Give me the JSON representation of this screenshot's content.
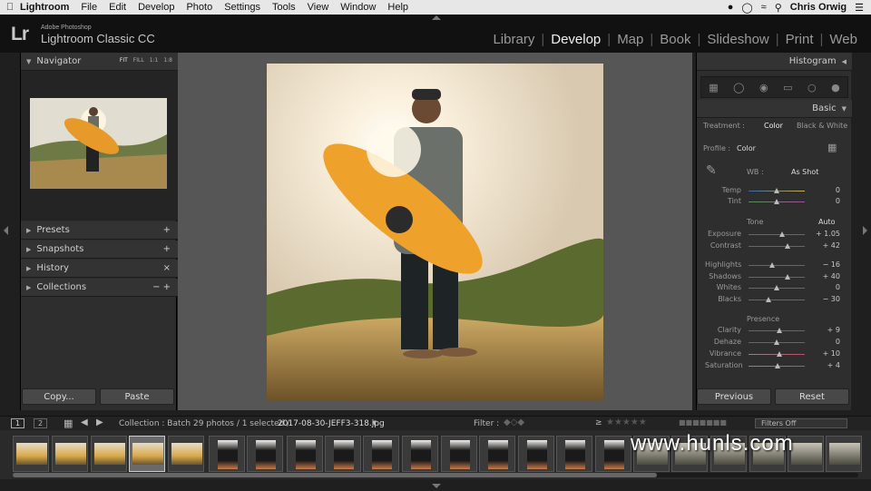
{
  "macbar": {
    "app": "Lightroom",
    "menus": [
      "File",
      "Edit",
      "Develop",
      "Photo",
      "Settings",
      "Tools",
      "View",
      "Window",
      "Help"
    ],
    "user": "Chris Orwig"
  },
  "header": {
    "logo": "Lr",
    "brand_top": "Adobe Photoshop",
    "brand_main": "Lightroom Classic CC",
    "modules": [
      "Library",
      "Develop",
      "Map",
      "Book",
      "Slideshow",
      "Print",
      "Web"
    ],
    "active_module": "Develop"
  },
  "left_panel": {
    "navigator_title": "Navigator",
    "nav_modes": [
      "FIT",
      "FILL",
      "1:1",
      "1:8"
    ],
    "sections": [
      {
        "title": "Presets",
        "action": "+"
      },
      {
        "title": "Snapshots",
        "action": "+"
      },
      {
        "title": "History",
        "action": "×"
      },
      {
        "title": "Collections",
        "action": "− +"
      }
    ],
    "copy_label": "Copy...",
    "paste_label": "Paste"
  },
  "right_panel": {
    "histogram_title": "Histogram",
    "basic_title": "Basic",
    "treatment_label": "Treatment :",
    "treatment_color": "Color",
    "treatment_bw": "Black & White",
    "profile_label": "Profile :",
    "profile_value": "Color",
    "wb_label": "WB :",
    "wb_value": "As Shot",
    "tone_label": "Tone",
    "auto_label": "Auto",
    "presence_label": "Presence",
    "sliders": [
      {
        "label": "Temp",
        "value": "0",
        "pos": 0.5
      },
      {
        "label": "Tint",
        "value": "0",
        "pos": 0.5
      },
      {
        "label": "Exposure",
        "value": "+ 1.05",
        "pos": 0.6
      },
      {
        "label": "Contrast",
        "value": "+ 42",
        "pos": 0.7
      },
      {
        "label": "Highlights",
        "value": "− 16",
        "pos": 0.42
      },
      {
        "label": "Shadows",
        "value": "+ 40",
        "pos": 0.7
      },
      {
        "label": "Whites",
        "value": "0",
        "pos": 0.5
      },
      {
        "label": "Blacks",
        "value": "− 30",
        "pos": 0.35
      },
      {
        "label": "Clarity",
        "value": "+ 9",
        "pos": 0.55
      },
      {
        "label": "Dehaze",
        "value": "0",
        "pos": 0.5
      },
      {
        "label": "Vibrance",
        "value": "+ 10",
        "pos": 0.55
      },
      {
        "label": "Saturation",
        "value": "+ 4",
        "pos": 0.52
      }
    ],
    "previous_label": "Previous",
    "reset_label": "Reset"
  },
  "filmstrip_bar": {
    "view1": "1",
    "view2": "2",
    "source": "Collection : Batch",
    "count": "29 photos / 1 selected /",
    "filename": "2017-08-30-JEFF3-318.jpg",
    "filter_label": "Filter :",
    "filters_off": "Filters Off",
    "rating_op": "≥"
  },
  "watermark": "www.hunls.com",
  "colors": {
    "accent": "#f0a02a",
    "panel": "#2e2e2e",
    "bg": "#1f1f1f"
  }
}
